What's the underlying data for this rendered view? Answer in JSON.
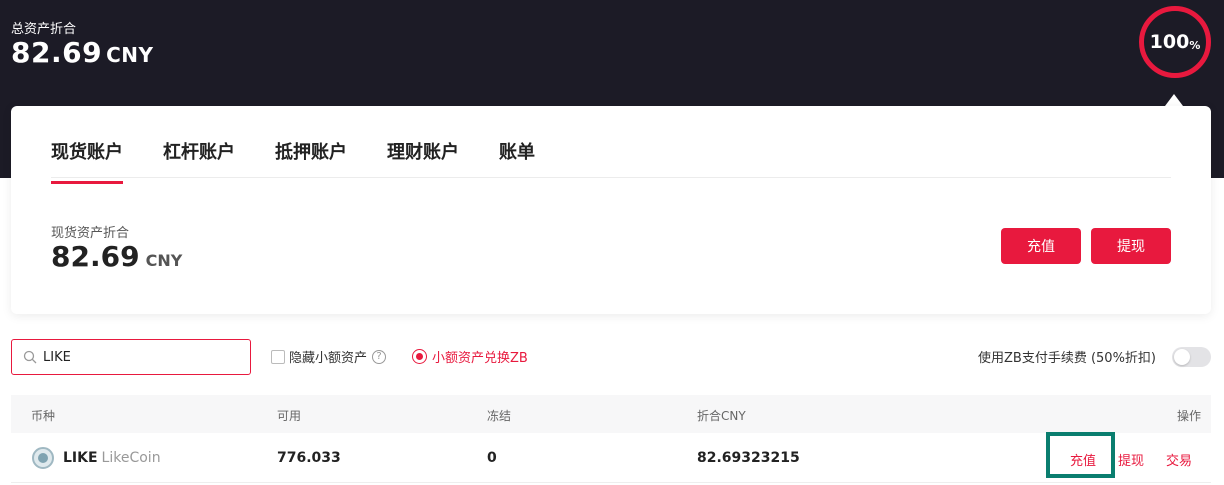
{
  "header": {
    "total_label": "总资产折合",
    "total_value": "82.69",
    "total_unit": "CNY",
    "ratio_value": "100",
    "ratio_unit": "%"
  },
  "tabs": [
    {
      "label": "现货账户",
      "active": true
    },
    {
      "label": "杠杆账户",
      "active": false
    },
    {
      "label": "抵押账户",
      "active": false
    },
    {
      "label": "理财账户",
      "active": false
    },
    {
      "label": "账单",
      "active": false
    }
  ],
  "spot_summary": {
    "label": "现货资产折合",
    "value": "82.69",
    "unit": "CNY",
    "deposit_label": "充值",
    "withdraw_label": "提现"
  },
  "filters": {
    "search_value": "LIKE",
    "search_icon": "search-icon",
    "hide_small_label": "隐藏小额资产",
    "help_glyph": "?",
    "convert_label": "小额资产兑换ZB",
    "fee_label": "使用ZB支付手续费 (50%折扣)",
    "fee_toggle_on": false
  },
  "table": {
    "columns": [
      "币种",
      "可用",
      "冻结",
      "折合CNY",
      "操作"
    ],
    "rows": [
      {
        "symbol": "LIKE",
        "name": "LikeCoin",
        "available": "776.033",
        "frozen": "0",
        "cny": "82.69323215",
        "actions": [
          "充值",
          "提现",
          "交易"
        ]
      }
    ]
  },
  "colors": {
    "brand_red": "#e8193e",
    "header_bg": "#1c1b26",
    "highlight": "#0a7e6f"
  }
}
